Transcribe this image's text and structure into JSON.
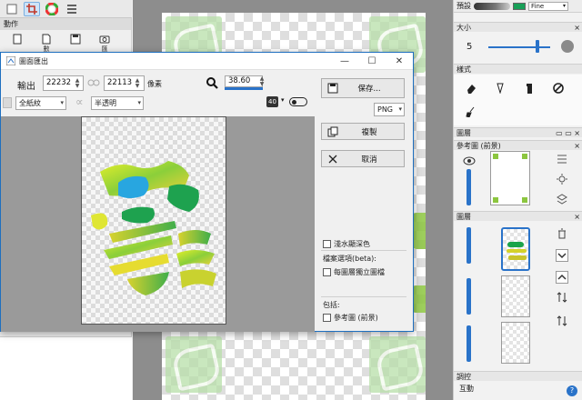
{
  "top_toolbar": {
    "icons": [
      "layers-icon",
      "crop-icon",
      "color-wheel-icon",
      "menu-icon"
    ]
  },
  "left_panel": {
    "section_title": "動作",
    "actions": [
      {
        "label": "",
        "icon": "new-page-icon"
      },
      {
        "label": "數",
        "icon": "document-icon"
      },
      {
        "label": "",
        "icon": "save-icon"
      },
      {
        "label": "匯",
        "icon": "camera-icon"
      }
    ]
  },
  "right_panel": {
    "brush_label": "預設",
    "brush_mode": "Fine",
    "size_title": "大小",
    "size_value": "5",
    "size_level": 0.8,
    "style_title": "樣式",
    "style_icons": [
      "eraser-icon",
      "pen-nib-icon",
      "spray-bottle-icon",
      "no-sign-icon",
      "broom-icon"
    ],
    "paper_title": "圖層",
    "reference_title": "參考圖 (前景)",
    "layers_title": "圖層",
    "adjust_title": "調控",
    "interact_label": "互動"
  },
  "dialog": {
    "title": "圖面匯出",
    "export_label": "輸出",
    "width_value": "22232",
    "height_value": "22113",
    "unit_label": "像素",
    "zoom_value": "38.60",
    "paper_select": "全紙紋",
    "transparency_select": "半透明",
    "save_button": "保存...",
    "format_select": "PNG",
    "copy_button": "複製",
    "cancel_button": "取消",
    "watermark_option": "淺水顯深色",
    "file_options_label": "檔案選項(beta):",
    "separate_layers_option": "每圖層獨立圖檔",
    "include_label": "包括:",
    "reference_option": "參考圖 (前景)",
    "badge_text": "40"
  },
  "colors": {
    "accent": "#2a73c9",
    "dialog_border": "#1e6fbf",
    "canvas_bg": "#8d8d8d",
    "preview_bg": "#9a9a9a"
  }
}
